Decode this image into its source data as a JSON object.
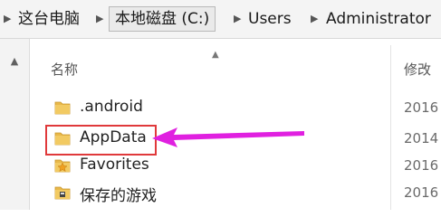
{
  "address_bar": {
    "segments": [
      "这台电脑",
      "本地磁盘 (C:)",
      "Users",
      "Administrator"
    ]
  },
  "columns": {
    "name": "名称",
    "modified": "修改"
  },
  "files": [
    {
      "name": ".android",
      "date": "2016",
      "icon": "folder-icon"
    },
    {
      "name": "AppData",
      "date": "2014",
      "icon": "folder-icon"
    },
    {
      "name": "Favorites",
      "date": "2016",
      "icon": "favorites-folder-icon"
    },
    {
      "name": "保存的游戏",
      "date": "2016",
      "icon": "saved-games-folder-icon"
    }
  ],
  "colors": {
    "highlight": "#e0393b",
    "arrow": "#e020e0",
    "folder": "#e8b84a"
  }
}
